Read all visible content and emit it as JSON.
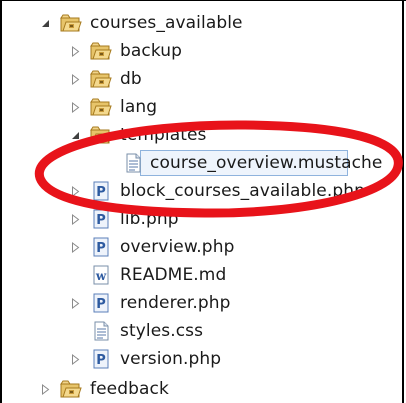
{
  "tree": {
    "rows": [
      {
        "label": "courses_available",
        "icon": "package-folder-icon",
        "twisty": "expanded"
      },
      {
        "label": "backup",
        "icon": "package-folder-icon",
        "twisty": "collapsed"
      },
      {
        "label": "db",
        "icon": "package-folder-icon",
        "twisty": "collapsed"
      },
      {
        "label": "lang",
        "icon": "package-folder-icon",
        "twisty": "collapsed"
      },
      {
        "label": "templates",
        "icon": "package-folder-icon",
        "twisty": "expanded"
      },
      {
        "label": "course_overview.mustache",
        "icon": "text-file-icon",
        "twisty": "none"
      },
      {
        "label": "block_courses_available.php",
        "icon": "php-file-icon",
        "twisty": "collapsed"
      },
      {
        "label": "lib.php",
        "icon": "php-file-icon",
        "twisty": "collapsed"
      },
      {
        "label": "overview.php",
        "icon": "php-file-icon",
        "twisty": "collapsed"
      },
      {
        "label": "README.md",
        "icon": "word-file-icon",
        "twisty": "none"
      },
      {
        "label": "renderer.php",
        "icon": "php-file-icon",
        "twisty": "collapsed"
      },
      {
        "label": "styles.css",
        "icon": "text-file-icon",
        "twisty": "none"
      },
      {
        "label": "version.php",
        "icon": "php-file-icon",
        "twisty": "collapsed"
      },
      {
        "label": "feedback",
        "icon": "package-folder-icon",
        "twisty": "collapsed"
      }
    ]
  },
  "colors": {
    "highlight_ellipse": "#e8131a",
    "selection_border": "#8fb3dd",
    "selection_fill": "#eef4fc"
  }
}
